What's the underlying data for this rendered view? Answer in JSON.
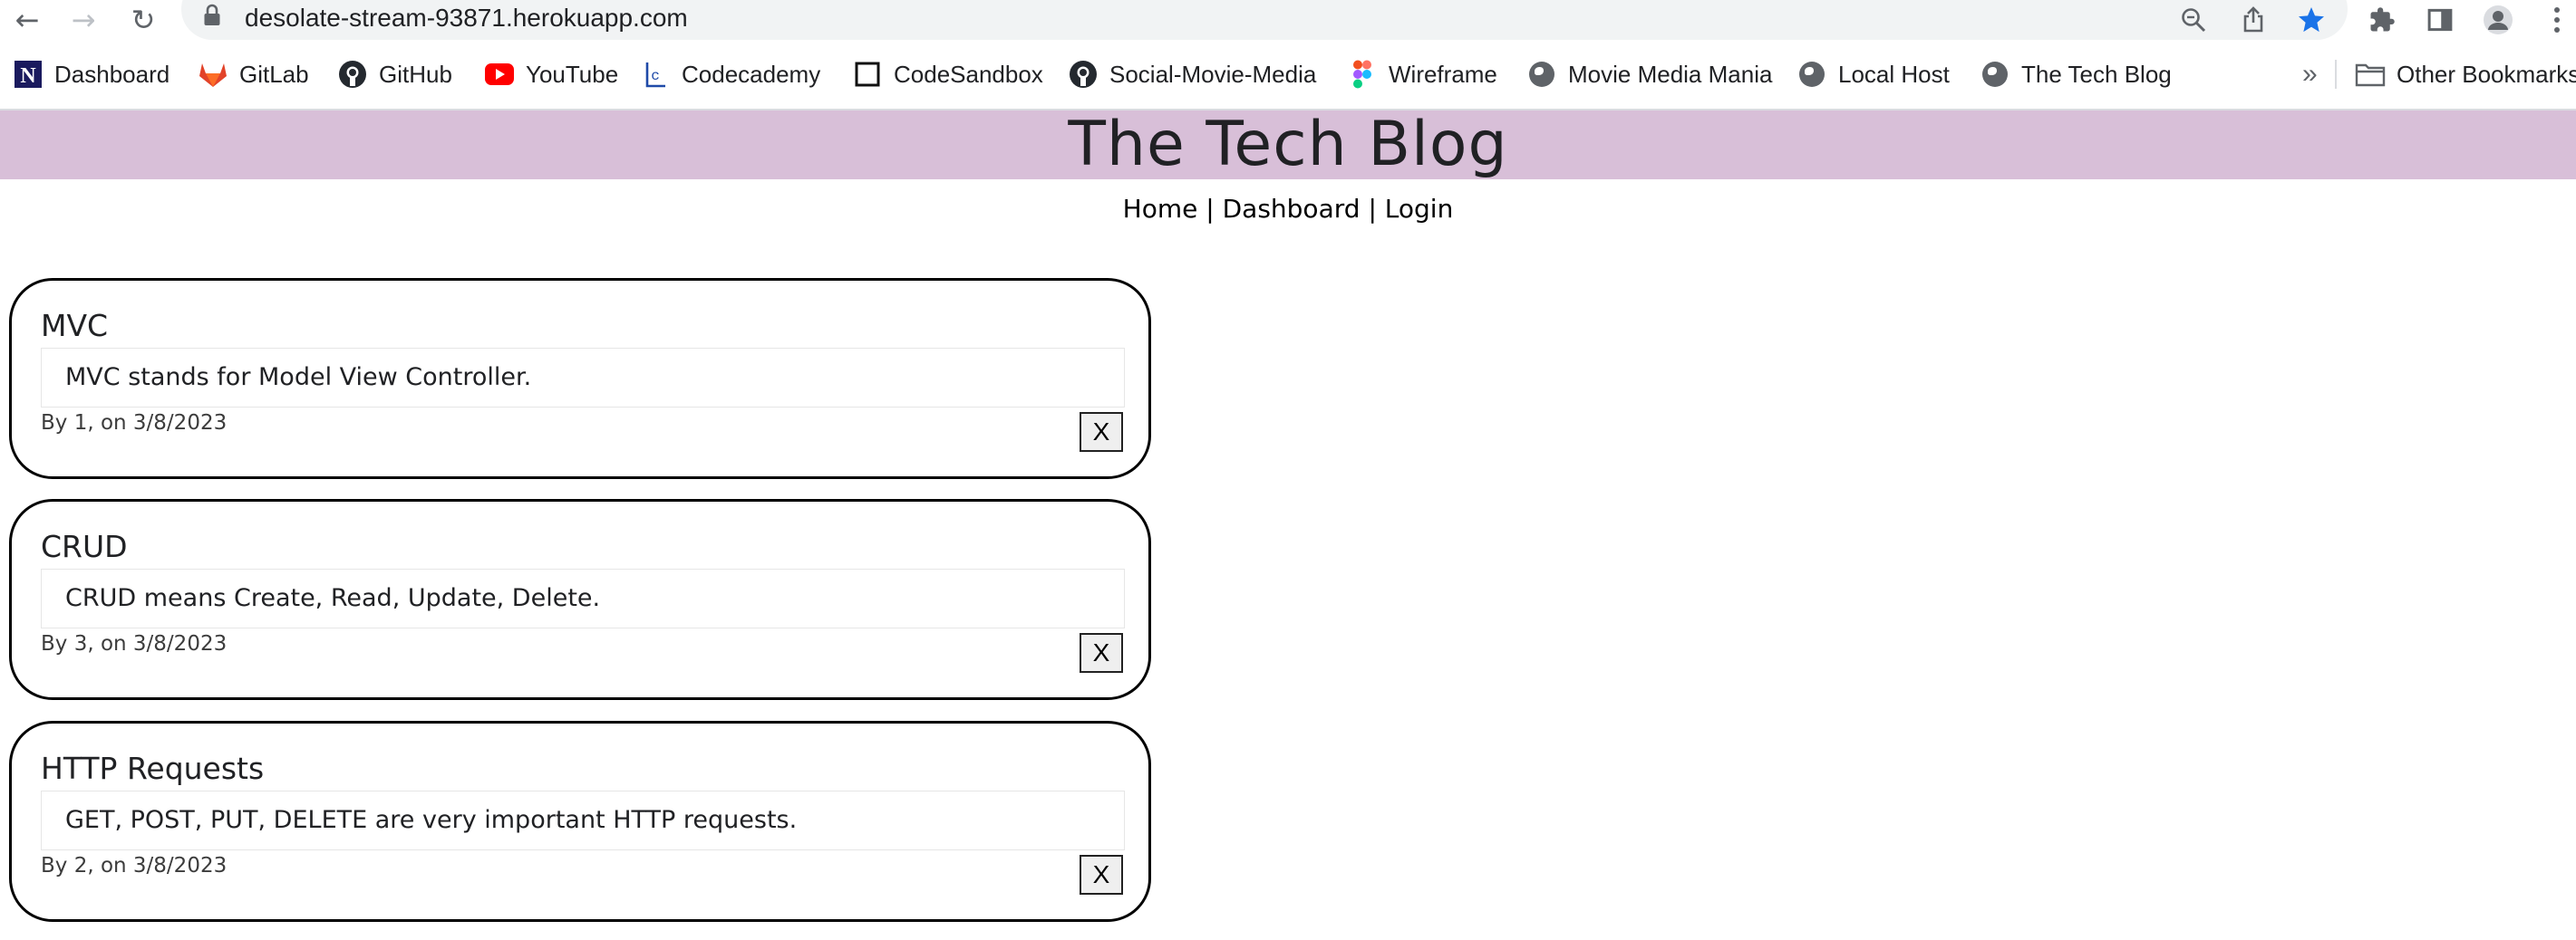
{
  "browser": {
    "url": "desolate-stream-93871.herokuapp.com",
    "bookmarks": [
      {
        "label": "Dashboard",
        "icon": "notion-icon"
      },
      {
        "label": "GitLab",
        "icon": "gitlab-icon"
      },
      {
        "label": "GitHub",
        "icon": "github-icon"
      },
      {
        "label": "YouTube",
        "icon": "youtube-icon"
      },
      {
        "label": "Codecademy",
        "icon": "codecademy-icon"
      },
      {
        "label": "CodeSandbox",
        "icon": "codesandbox-icon"
      },
      {
        "label": "Social-Movie-Media",
        "icon": "github-icon"
      },
      {
        "label": "Wireframe",
        "icon": "figma-icon"
      },
      {
        "label": "Movie Media Mania",
        "icon": "globe-icon"
      },
      {
        "label": "Local Host",
        "icon": "globe-icon"
      },
      {
        "label": "The Tech Blog",
        "icon": "globe-icon"
      }
    ],
    "overflow_label": "»",
    "other_bookmarks": "Other Bookmarks"
  },
  "site": {
    "title": "The Tech Blog",
    "nav": {
      "home": "Home",
      "sep1": "|",
      "dashboard": "Dashboard",
      "sep2": "|",
      "login": "Login"
    },
    "header_color": "#d8bfd8"
  },
  "posts": [
    {
      "title": "MVC",
      "body": "MVC stands for Model View Controller.",
      "meta": "By 1, on 3/8/2023",
      "delete_label": "X"
    },
    {
      "title": "CRUD",
      "body": "CRUD means Create, Read, Update, Delete.",
      "meta": "By 3, on 3/8/2023",
      "delete_label": "X"
    },
    {
      "title": "HTTP Requests",
      "body": "GET, POST, PUT, DELETE are very important HTTP requests.",
      "meta": "By 2, on 3/8/2023",
      "delete_label": "X"
    }
  ]
}
